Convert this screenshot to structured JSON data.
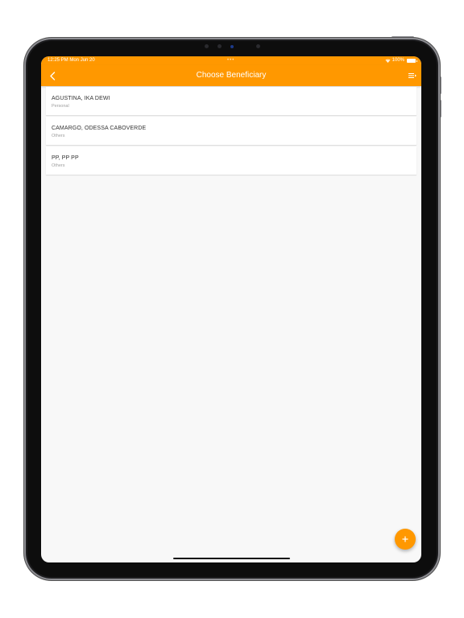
{
  "status_bar": {
    "time": "12:25 PM  Mon Jun 20",
    "dots": "•••",
    "battery": "100%"
  },
  "app_bar": {
    "title": "Choose Beneficiary",
    "back_icon": "chevron-left-icon",
    "menu_icon": "menu-icon"
  },
  "beneficiaries": [
    {
      "name": "AGUSTINA, IKA DEWI",
      "type": "Personal"
    },
    {
      "name": "CAMARGO, ODESSA CABOVERDE",
      "type": "Others"
    },
    {
      "name": "PP, PP PP",
      "type": "Others"
    }
  ],
  "fab": {
    "label": "+",
    "icon": "plus-icon"
  },
  "colors": {
    "accent": "#ff9800",
    "background": "#f8f8f8",
    "card": "#ffffff"
  }
}
